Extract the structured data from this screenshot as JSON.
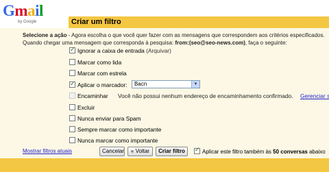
{
  "logo": {
    "letters": [
      "G",
      "m",
      "a",
      "i",
      "l"
    ],
    "letter_colors": [
      "#3369e8",
      "#d50f25",
      "#eeb211",
      "#3369e8",
      "#009925"
    ],
    "byline": "by Google"
  },
  "header": {
    "title": "Criar um filtro"
  },
  "instructions": {
    "bold": "Selecione a ação",
    "rest": " - Agora escolha o que você quer fazer com as mensagens que correspondem aos critérios especificados.",
    "line2_prefix": "Quando chegar uma mensagem que corresponda à pesquisa: ",
    "query": "from:(seo@seo-news.com)",
    "line2_suffix": ", faça o seguinte:"
  },
  "options": {
    "skip_inbox": {
      "label": "Ignorar a caixa de entrada",
      "sub": " (Arquivar)",
      "checked": true
    },
    "mark_read": {
      "label": "Marcar como lida",
      "checked": false
    },
    "star": {
      "label": "Marcar com estrela",
      "checked": false
    },
    "apply_label": {
      "label": "Aplicar o marcador:",
      "checked": true,
      "selected": "Bacn"
    },
    "forward": {
      "label": "Encaminhar",
      "note": "Você não possui nenhum endereço de encaminhamento confirmado.",
      "link": "Gerenciar seus e"
    },
    "delete": {
      "label": "Excluir",
      "checked": false
    },
    "never_spam": {
      "label": "Nunca enviar para Spam",
      "checked": false
    },
    "always_important": {
      "label": "Sempre marcar como importante",
      "checked": false
    },
    "never_important": {
      "label": "Nunca marcar como importante",
      "checked": false
    }
  },
  "footer": {
    "show_filters_link": "Mostrar filtros atuais",
    "cancel_label": "Cancelar",
    "back_label": "« Voltar",
    "create_label": "Criar filtro",
    "apply_prefix": "Aplicar este filtro também às ",
    "apply_count": "50 conversas",
    "apply_suffix": " abaixo",
    "apply_checked": true
  },
  "colors": {
    "accent_bar": "#f4c742",
    "panel_bg": "#fcf8e5",
    "link": "#2222cc"
  }
}
